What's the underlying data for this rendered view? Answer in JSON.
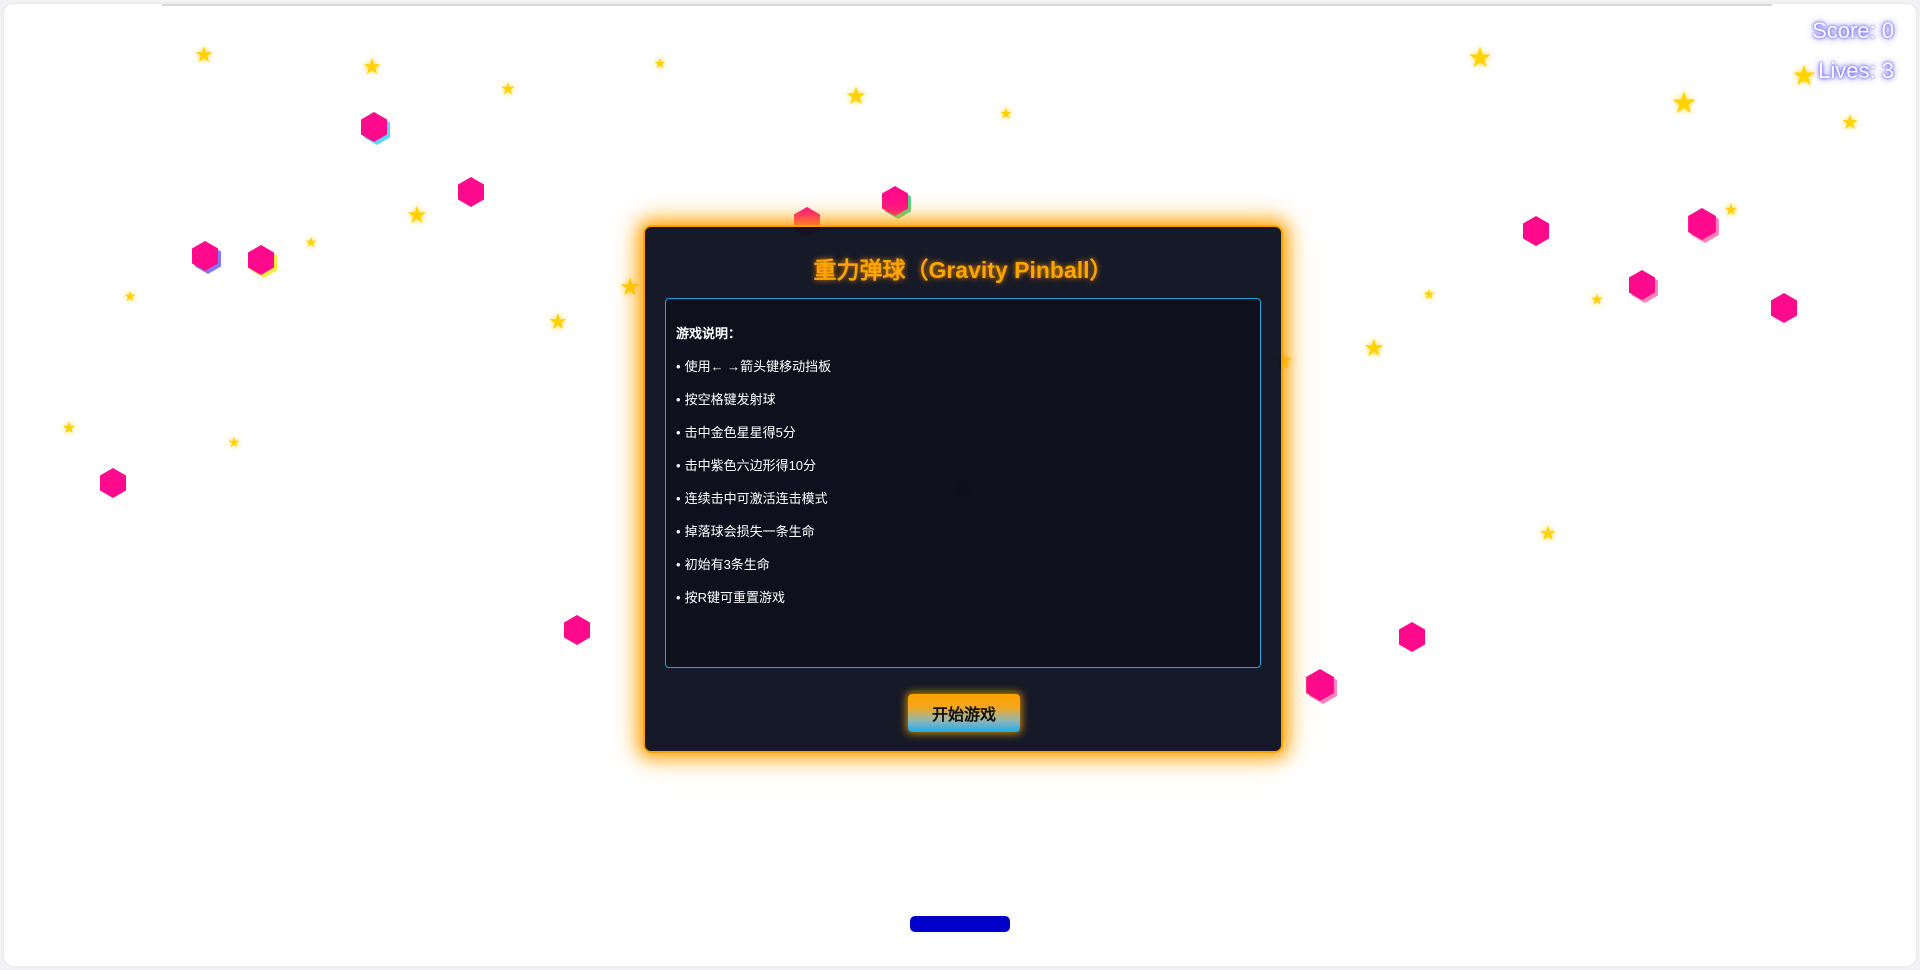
{
  "hud": {
    "score_text": "Score: 0",
    "lives_text": "Lives: 3"
  },
  "modal": {
    "title": "重力弹球（Gravity Pinball）",
    "instructions_heading": "游戏说明：",
    "rules": [
      "使用← →箭头键移动挡板",
      "按空格键发射球",
      "击中金色星星得5分",
      "击中紫色六边形得10分",
      "连续击中可激活连击模式",
      "掉落球会损失一条生命",
      "初始有3条生命",
      "按R键可重置游戏"
    ],
    "bullet_char": "•",
    "start_button_label": "开始游戏"
  },
  "colors": {
    "star": "#ffd200",
    "hexagon": "#ff0a8c",
    "paddle": "#0000c8",
    "modal_border": "#ffa200",
    "title": "#ffa500",
    "instructions_border": "#1ea2e6"
  },
  "icons": {
    "star_target": "star-icon",
    "hexagon_target": "hexagon-icon"
  }
}
